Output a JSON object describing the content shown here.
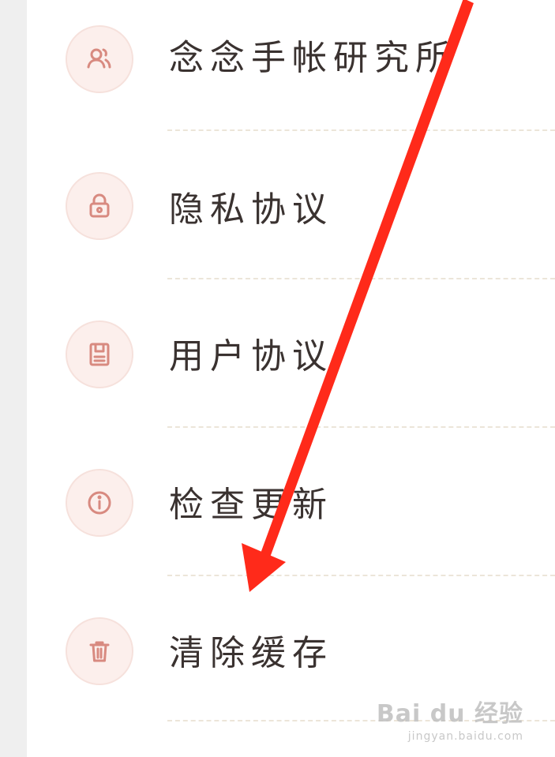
{
  "menu": {
    "items": [
      {
        "label": "念念手帐研究所",
        "icon": "users-icon"
      },
      {
        "label": "隐私协议",
        "icon": "lock-icon"
      },
      {
        "label": "用户协议",
        "icon": "document-icon"
      },
      {
        "label": "检查更新",
        "icon": "info-icon"
      },
      {
        "label": "清除缓存",
        "icon": "trash-icon"
      }
    ]
  },
  "annotation": {
    "type": "arrow",
    "color": "#ff2a1a",
    "points_to": "清除缓存"
  },
  "watermark": {
    "brand": "Bai du 经验",
    "url": "jingyan.baidu.com"
  },
  "colors": {
    "icon_stroke": "#d88a80",
    "icon_bg": "#fcefec",
    "divider": "#ece5d9",
    "text": "#3a3230"
  }
}
